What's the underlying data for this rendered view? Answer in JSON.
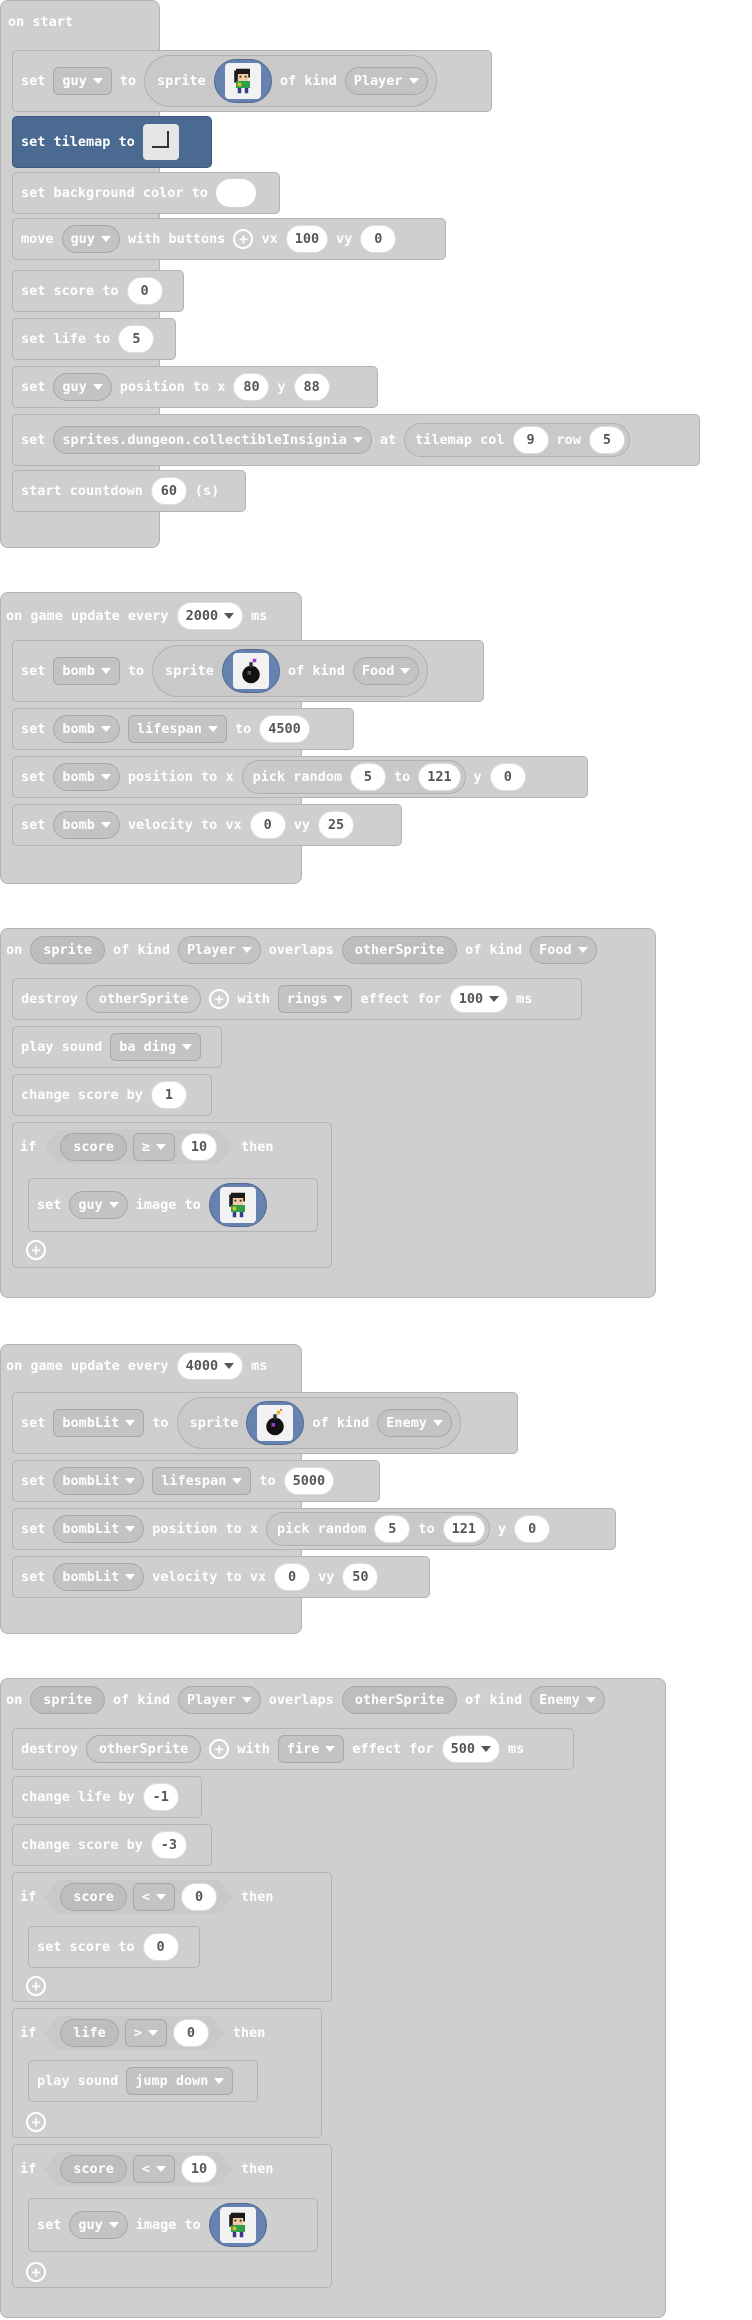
{
  "on_start": {
    "hat": "on start",
    "set_guy": {
      "set": "set",
      "var": "guy",
      "to": "to",
      "sprite": "sprite",
      "of_kind": "of kind",
      "kind": "Player",
      "image_icon": "player-sprite-icon"
    },
    "set_tilemap": {
      "label": "set tilemap to",
      "icon": "tilemap-icon"
    },
    "set_bg": {
      "label": "set background color to",
      "color": "#ffffff"
    },
    "move": {
      "move": "move",
      "var": "guy",
      "with_buttons": "with buttons",
      "vx_label": "vx",
      "vx": "100",
      "vy_label": "vy",
      "vy": "0"
    },
    "set_score": {
      "label": "set score to",
      "value": "0"
    },
    "set_life": {
      "label": "set life to",
      "value": "5"
    },
    "set_pos": {
      "set": "set",
      "var": "guy",
      "pos": "position to x",
      "x": "80",
      "y_label": "y",
      "y": "88"
    },
    "set_tile": {
      "set": "set",
      "tile": "sprites.dungeon.collectibleInsignia",
      "at": "at",
      "tilemap_col": "tilemap col",
      "col": "9",
      "row_label": "row",
      "row": "5"
    },
    "countdown": {
      "label": "start countdown",
      "value": "60",
      "unit": "(s)"
    }
  },
  "update_2000": {
    "hat_prefix": "on game update every",
    "interval": "2000",
    "ms": "ms",
    "set_bomb": {
      "set": "set",
      "var": "bomb",
      "to": "to",
      "sprite": "sprite",
      "of_kind": "of kind",
      "kind": "Food",
      "image_icon": "bomb-sprite-icon"
    },
    "lifespan": {
      "set": "set",
      "var": "bomb",
      "prop": "lifespan",
      "to": "to",
      "value": "4500"
    },
    "position": {
      "set": "set",
      "var": "bomb",
      "pos": "position to x",
      "pick_random": "pick random",
      "from": "5",
      "to": "to",
      "max": "121",
      "y_label": "y",
      "y": "0"
    },
    "velocity": {
      "set": "set",
      "var": "bomb",
      "vel": "velocity to vx",
      "vx": "0",
      "vy_label": "vy",
      "vy": "25"
    }
  },
  "overlap_food": {
    "on": "on",
    "sprite": "sprite",
    "of_kind": "of kind",
    "kind1": "Player",
    "overlaps": "overlaps",
    "other": "otherSprite",
    "of_kind2": "of kind",
    "kind2": "Food",
    "destroy": {
      "label": "destroy",
      "var": "otherSprite",
      "with": "with",
      "effect": "rings",
      "effect_for": "effect for",
      "duration": "100",
      "ms": "ms"
    },
    "play_sound": {
      "label": "play sound",
      "sound": "ba ding"
    },
    "change_score": {
      "label": "change score by",
      "value": "1"
    },
    "if": {
      "if": "if",
      "var": "score",
      "op": "≥",
      "value": "10",
      "then": "then"
    },
    "set_image": {
      "set": "set",
      "var": "guy",
      "label": "image to",
      "image_icon": "player-sprite-icon"
    }
  },
  "update_4000": {
    "hat_prefix": "on game update every",
    "interval": "4000",
    "ms": "ms",
    "set_bomb": {
      "set": "set",
      "var": "bombLit",
      "to": "to",
      "sprite": "sprite",
      "of_kind": "of kind",
      "kind": "Enemy",
      "image_icon": "lit-bomb-sprite-icon"
    },
    "lifespan": {
      "set": "set",
      "var": "bombLit",
      "prop": "lifespan",
      "to": "to",
      "value": "5000"
    },
    "position": {
      "set": "set",
      "var": "bombLit",
      "pos": "position to x",
      "pick_random": "pick random",
      "from": "5",
      "to": "to",
      "max": "121",
      "y_label": "y",
      "y": "0"
    },
    "velocity": {
      "set": "set",
      "var": "bombLit",
      "vel": "velocity to vx",
      "vx": "0",
      "vy_label": "vy",
      "vy": "50"
    }
  },
  "overlap_enemy": {
    "on": "on",
    "sprite": "sprite",
    "of_kind": "of kind",
    "kind1": "Player",
    "overlaps": "overlaps",
    "other": "otherSprite",
    "of_kind2": "of kind",
    "kind2": "Enemy",
    "destroy": {
      "label": "destroy",
      "var": "otherSprite",
      "with": "with",
      "effect": "fire",
      "effect_for": "effect for",
      "duration": "500",
      "ms": "ms"
    },
    "change_life": {
      "label": "change life by",
      "value": "-1"
    },
    "change_score": {
      "label": "change score by",
      "value": "-3"
    },
    "if1": {
      "if": "if",
      "var": "score",
      "op": "<",
      "value": "0",
      "then": "then"
    },
    "set_score": {
      "label": "set score to",
      "value": "0"
    },
    "if2": {
      "if": "if",
      "var": "life",
      "op": ">",
      "value": "0",
      "then": "then"
    },
    "play_sound": {
      "label": "play sound",
      "sound": "jump down"
    },
    "if3": {
      "if": "if",
      "var": "score",
      "op": "<",
      "value": "10",
      "then": "then"
    },
    "set_image": {
      "set": "set",
      "var": "guy",
      "label": "image to",
      "image_icon": "player-sprite-icon"
    }
  }
}
